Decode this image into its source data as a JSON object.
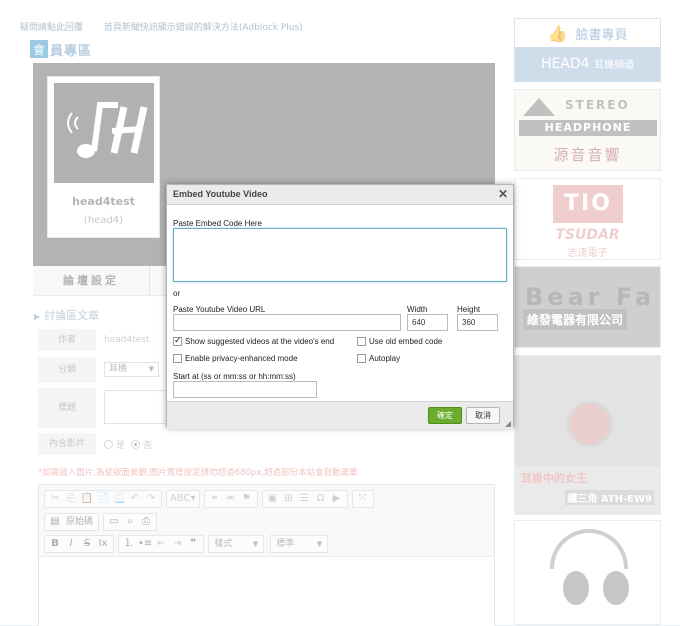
{
  "top_links": [
    "疑問請點此回覆",
    "首頁新聞快訊顯示錯誤的解決方法(Adblock Plus)"
  ],
  "member": {
    "icon_glyph": "會",
    "title": "員專區",
    "profile_name": "head4test",
    "profile_id": "(head4)"
  },
  "tabs": [
    "論壇設定"
  ],
  "section_title": "討論區文章",
  "form": {
    "author_label": "作者",
    "author_value": "head4test",
    "category_label": "分類",
    "category_value": "耳機",
    "title_label": "標題",
    "video_label": "內含影片",
    "video_options": [
      "是",
      "否"
    ],
    "video_selected": "否",
    "warning": "*如需插入圖片,為使版面美觀,圖片寬度設定請勿超過680px,超過部份本站會自動選單"
  },
  "editor": {
    "row2_source": "原始碼",
    "format_combo": "樣式",
    "style_combo": "標準"
  },
  "sidebar": {
    "fan_page_label": "臉書專頁",
    "channel_label": "HEAD4",
    "channel_sub": "耳機頻道",
    "ads": [
      {
        "line1": "STEREO",
        "line2": "HEADPHONE",
        "line3": "源音音響"
      },
      {
        "logo": "TIO",
        "line1": "TSUDAR",
        "line2": "志達電子"
      },
      {
        "line1": "Bear Fa",
        "line2": "維發電器有限公司"
      },
      {
        "line1": "耳掛中的女王",
        "line2": "鐵三角 ATH-EW9"
      },
      {}
    ]
  },
  "dialog": {
    "title": "Embed Youtube Video",
    "close_glyph": "✕",
    "paste_label": "Paste Embed Code Here",
    "or_label": "or",
    "url_label": "Paste Youtube Video URL",
    "width_label": "Width",
    "width_value": "640",
    "height_label": "Height",
    "height_value": "360",
    "opt_suggested": "Show suggested videos at the video's end",
    "opt_suggested_checked": true,
    "opt_old_embed": "Use old embed code",
    "opt_old_embed_checked": false,
    "opt_privacy": "Enable privacy-enhanced mode",
    "opt_privacy_checked": false,
    "opt_autoplay": "Autoplay",
    "opt_autoplay_checked": false,
    "start_label": "Start at (ss or mm:ss or hh:mm:ss)",
    "ok_label": "確定",
    "cancel_label": "取消"
  },
  "colors": {
    "ok_button": "#6aad2c",
    "focus_border": "#66b3ce",
    "channel_band": "#a8c2da"
  }
}
